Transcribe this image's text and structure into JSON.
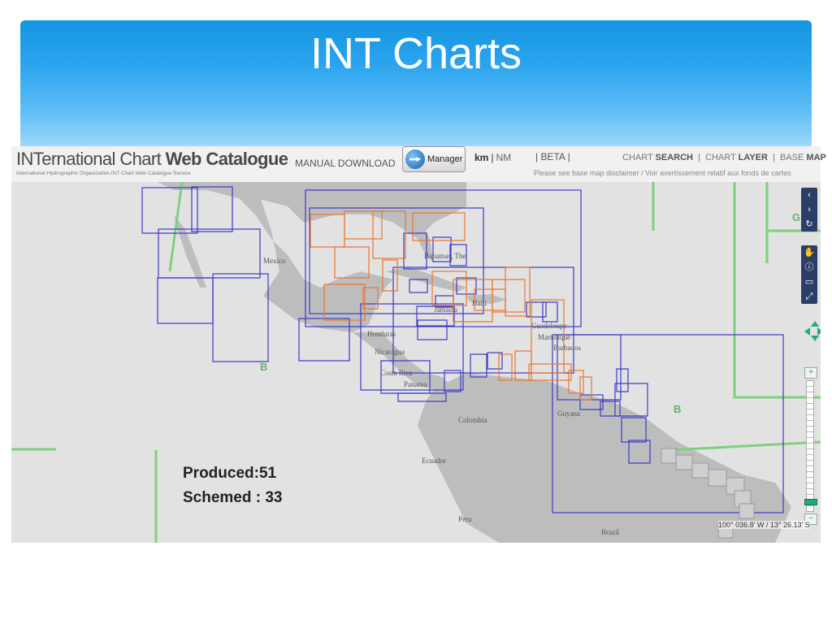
{
  "slide": {
    "title": "INT Charts"
  },
  "app": {
    "title_part1": "INTernational Chart ",
    "title_part2": "Web Catalogue",
    "subtitle": "International Hydrographic Organization INT Chart Web Catalogue Service",
    "manual_download": "MANUAL DOWNLOAD",
    "manager_label": "Manager",
    "unit_km": "km",
    "unit_sep": "|",
    "unit_nm": "NM",
    "beta": "|   BETA   |",
    "links": {
      "chart_search_1": "CHART ",
      "chart_search_2": "SEARCH",
      "chart_layer_1": "CHART ",
      "chart_layer_2": "LAYER",
      "base_map_1": "BASE ",
      "base_map_2": "MAP"
    },
    "disclaimer": "Please see base map disclaimer / Voir avertissement relatif aux fonds de cartes"
  },
  "map": {
    "labels": {
      "mexico": "Mexico",
      "bahamas": "Bahamas, The",
      "haiti": "Haiti",
      "jamaica": "Jamaica",
      "honduras": "Honduras",
      "nicaragua": "Nicaragua",
      "costa_rica": "Costa Rica",
      "panama": "Panama",
      "guadeloupe": "Guadeloupe",
      "martinique": "Martinique",
      "barbados": "Barbados",
      "guyana": "Guyana",
      "colombia": "Colombia",
      "ecuador": "Ecuador",
      "peru": "Peru",
      "brazil": "Brazil"
    },
    "zones": {
      "b_left": "B",
      "b_right": "B",
      "g": "G"
    },
    "coordinates": "100° 036.8' W  /  13° 26.13' S",
    "colors": {
      "produced": "#3a3ac8",
      "schemed": "#ea7530",
      "land": "#bdbdbd",
      "sea": "#e2e2e2",
      "boundary": "#7fcf7f"
    }
  },
  "controls": {
    "nav": [
      "‹",
      "›",
      "↻"
    ],
    "tools": [
      "✋",
      "ⓘ",
      "▭",
      "⤢"
    ],
    "zoom_in": "+",
    "zoom_out": "−",
    "zoom_level_fraction": 0.05
  },
  "stats": {
    "produced": "Produced:51",
    "schemed": "Schemed : 33"
  }
}
